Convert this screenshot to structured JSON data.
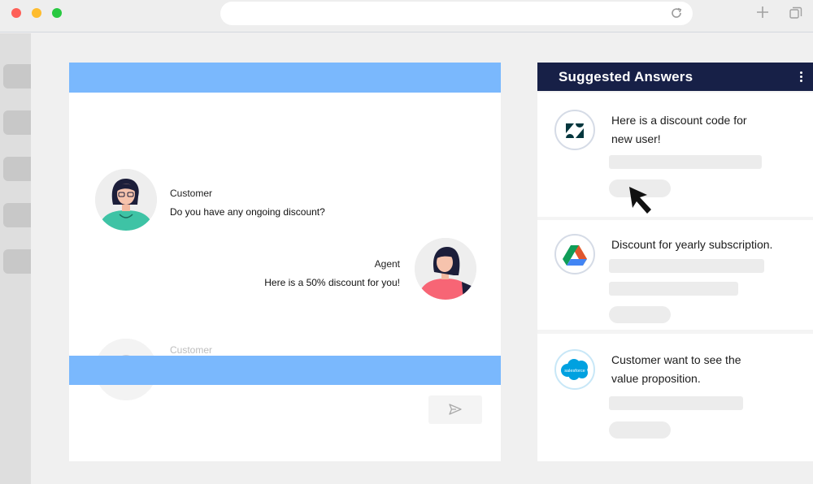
{
  "browser": {
    "window_controls": [
      "close",
      "minimize",
      "maximize"
    ],
    "url_text": "",
    "icons": [
      "reload-icon",
      "new-tab-icon",
      "tabs-icon"
    ]
  },
  "sidebar": {
    "items": [
      "",
      "",
      "",
      "",
      ""
    ]
  },
  "chat": {
    "messages": [
      {
        "role": "customer",
        "name": "Customer",
        "text": "Do you have any ongoing discount?"
      },
      {
        "role": "agent",
        "name": "Agent",
        "text": "Here is a 50% discount for you!"
      },
      {
        "role": "customer",
        "name": "Customer",
        "text": ""
      }
    ],
    "send_icon": "send-icon"
  },
  "suggested": {
    "title": "Suggested Answers",
    "menu_icon": "kebab-menu-icon",
    "cards": [
      {
        "source": "zendesk",
        "text_line1": "Here is a discount code for",
        "text_line2": "new user!"
      },
      {
        "source": "google-drive",
        "text_line1": "Discount for yearly subscription.",
        "text_line2": ""
      },
      {
        "source": "salesforce",
        "logo_text": "salesforce",
        "text_line1": "Customer want to see the",
        "text_line2": "value proposition."
      }
    ]
  },
  "colors": {
    "chat_bar": "#7ab8fd",
    "panel_header": "#172047",
    "zendesk_logo": "#03363d",
    "salesforce_logo": "#00a1e0"
  }
}
